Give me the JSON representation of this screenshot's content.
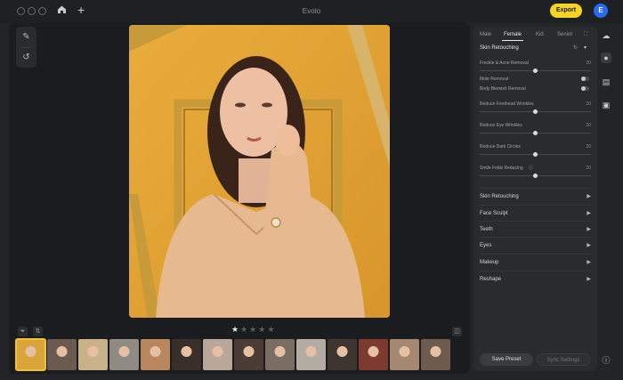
{
  "app": {
    "title": "Evoto"
  },
  "header": {
    "export_label": "Export",
    "avatar_letter": "E"
  },
  "tabs": [
    {
      "label": "Male",
      "active": false
    },
    {
      "label": "Female",
      "active": true
    },
    {
      "label": "Kid",
      "active": false
    },
    {
      "label": "Senior",
      "active": false
    }
  ],
  "skin_section": {
    "title": "Skin Retouching",
    "rows": [
      {
        "label": "Freckle & Acne Removal",
        "value": "20",
        "type": "slider",
        "level": 0.5
      },
      {
        "label": "Mole Removal",
        "type": "toggle",
        "on": false
      },
      {
        "label": "Body Blemish Removal",
        "type": "toggle",
        "on": false
      },
      {
        "label": "Reduce Forehead Wrinkles",
        "value": "20",
        "type": "slider",
        "level": 0.5
      },
      {
        "label": "Reduce Eye Wrinkles",
        "value": "20",
        "type": "slider",
        "level": 0.5
      },
      {
        "label": "Reduce Dark Circles",
        "value": "20",
        "type": "slider",
        "level": 0.5
      },
      {
        "label": "Smile Folds Reducing",
        "value": "20",
        "type": "slider",
        "level": 0.5
      }
    ]
  },
  "categories": [
    "Skin Retouching",
    "Face Sculpt",
    "Teeth",
    "Eyes",
    "Makeup",
    "Reshape"
  ],
  "buttons": {
    "save_preset": "Save Preset",
    "sync_settings": "Sync Settings"
  },
  "rating": {
    "stars": 5,
    "filled": 1
  },
  "thumbnails": [
    {
      "tag": "",
      "bg": "#d9a53b",
      "selected": true
    },
    {
      "tag": "",
      "bg": "#6b5a4f"
    },
    {
      "tag": "",
      "bg": "#c9b28a"
    },
    {
      "tag": "",
      "bg": "#8f8a84"
    },
    {
      "tag": "",
      "bg": "#b8875d"
    },
    {
      "tag": "",
      "bg": "#3a2e2a"
    },
    {
      "tag": "",
      "bg": "#b9a89a"
    },
    {
      "tag": "",
      "bg": "#4b3c35"
    },
    {
      "tag": "",
      "bg": "#7a6e63"
    },
    {
      "tag": "",
      "bg": "#b4aba3"
    },
    {
      "tag": "",
      "bg": "#3e3531"
    },
    {
      "tag": "",
      "bg": "#7c3b2e"
    },
    {
      "tag": "",
      "bg": "#a48872"
    },
    {
      "tag": "",
      "bg": "#6f5b4d"
    }
  ],
  "colors": {
    "accent": "#f5d523",
    "avatar": "#2a6af2",
    "panel": "#2a2b2e",
    "workspace": "#1b1c1f"
  }
}
